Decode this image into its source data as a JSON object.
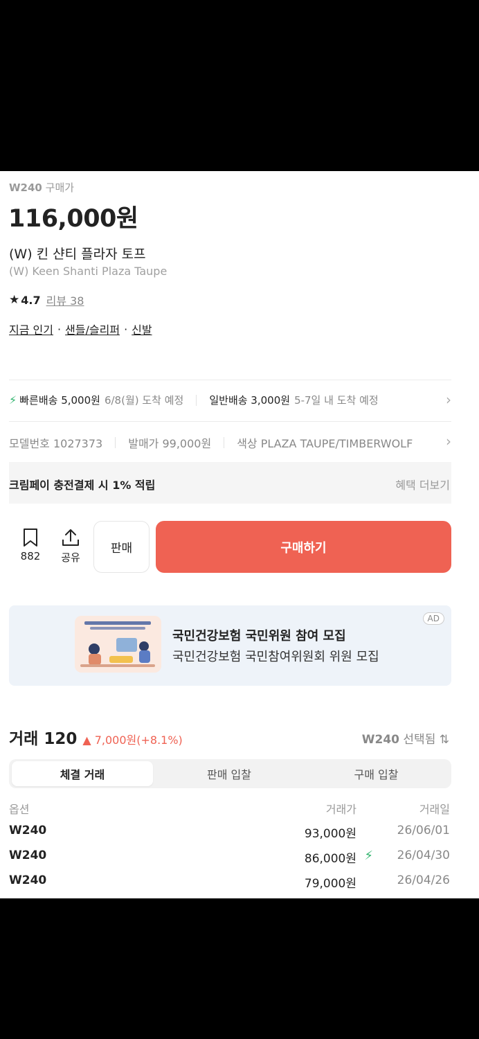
{
  "product": {
    "size_label": "W240",
    "price_type": "구매가",
    "price": "116,000원",
    "name_ko": "(W) 킨 샨티 플라자 토프",
    "name_en": "(W) Keen Shanti Plaza Taupe",
    "rating_star": "★",
    "rating": "4.7",
    "review_label": "리뷰 38",
    "categories": [
      "지금 인기",
      "샌들/슬리퍼",
      "신발"
    ],
    "category_sep": "·"
  },
  "shipping": {
    "fast_label": "빠른배송 5,000원",
    "fast_eta": "6/8(월) 도착 예정",
    "normal_label": "일반배송 3,000원",
    "normal_eta": "5-7일 내 도착 예정",
    "chevron": "›"
  },
  "info": {
    "model": "모델번호 1027373",
    "release_price": "발매가 99,000원",
    "color": "색상 PLAZA TAUPE/TIMBERWOLF",
    "chevron": "›"
  },
  "promo": {
    "text": "크림페이 충전결제 시 1% 적립",
    "more": "혜택 더보기"
  },
  "actions": {
    "wish_count": "882",
    "share_label": "공유",
    "sell_label": "판매",
    "buy_label": "구매하기"
  },
  "ad": {
    "badge": "AD",
    "title": "국민건강보험 국민위원 참여 모집",
    "subtitle": "국민건강보험 국민참여위원회 위원 모집"
  },
  "trades": {
    "title": "거래 120",
    "change": "▲ 7,000원(+8.1%)",
    "size_select_size": "W240",
    "size_select_label": "선택됨 ⇅",
    "tabs": [
      "체결 거래",
      "판매 입찰",
      "구매 입찰"
    ],
    "headers": [
      "옵션",
      "거래가",
      "거래일"
    ],
    "rows": [
      {
        "option": "W240",
        "price": "93,000원",
        "date": "26/06/01",
        "fast": false
      },
      {
        "option": "W240",
        "price": "86,000원",
        "date": "26/04/30",
        "fast": true
      },
      {
        "option": "W240",
        "price": "79,000원",
        "date": "26/04/26",
        "fast": false
      }
    ]
  },
  "colors": {
    "buy": "#ef6253",
    "fast": "#31b46e",
    "up": "#ef6253"
  }
}
